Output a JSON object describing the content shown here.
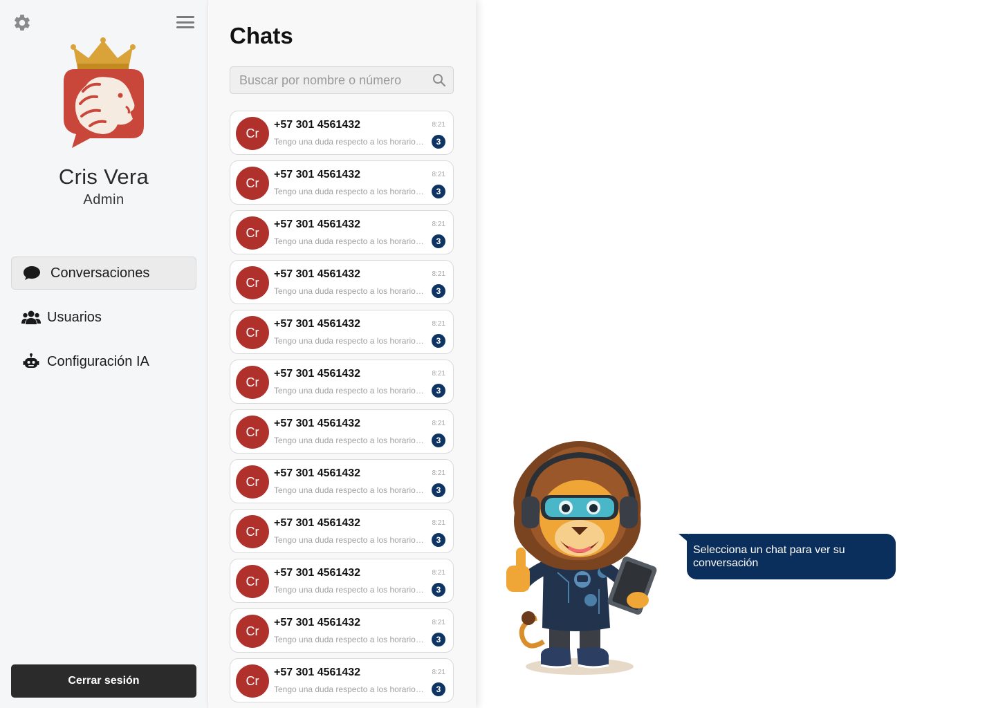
{
  "sidebar": {
    "icons": {
      "settings": "gear-icon",
      "menu": "hamburger-icon"
    },
    "logo_icon": "crowned-lion-logo",
    "user": {
      "name": "Cris Vera",
      "role": "Admin"
    },
    "nav": [
      {
        "label": "Conversaciones",
        "icon": "chat-bubble-icon",
        "active": true
      },
      {
        "label": "Usuarios",
        "icon": "users-icon",
        "active": false
      },
      {
        "label": "Configuración IA",
        "icon": "robot-icon",
        "active": false
      }
    ],
    "logout_label": "Cerrar sesión"
  },
  "chats": {
    "title": "Chats",
    "search": {
      "placeholder": "Buscar por nombre o número",
      "value": ""
    },
    "items": [
      {
        "initials": "Cr",
        "phone": "+57 301 4561432",
        "preview": "Tengo una duda respecto a los horarios de atención",
        "time": "8:21",
        "unread": "3"
      },
      {
        "initials": "Cr",
        "phone": "+57 301 4561432",
        "preview": "Tengo una duda respecto a los horarios de atención",
        "time": "8:21",
        "unread": "3"
      },
      {
        "initials": "Cr",
        "phone": "+57 301 4561432",
        "preview": "Tengo una duda respecto a los horarios de atención",
        "time": "8:21",
        "unread": "3"
      },
      {
        "initials": "Cr",
        "phone": "+57 301 4561432",
        "preview": "Tengo una duda respecto a los horarios de atención",
        "time": "8:21",
        "unread": "3"
      },
      {
        "initials": "Cr",
        "phone": "+57 301 4561432",
        "preview": "Tengo una duda respecto a los horarios de atención",
        "time": "8:21",
        "unread": "3"
      },
      {
        "initials": "Cr",
        "phone": "+57 301 4561432",
        "preview": "Tengo una duda respecto a los horarios de atención",
        "time": "8:21",
        "unread": "3"
      },
      {
        "initials": "Cr",
        "phone": "+57 301 4561432",
        "preview": "Tengo una duda respecto a los horarios de atención",
        "time": "8:21",
        "unread": "3"
      },
      {
        "initials": "Cr",
        "phone": "+57 301 4561432",
        "preview": "Tengo una duda respecto a los horarios de atención",
        "time": "8:21",
        "unread": "3"
      },
      {
        "initials": "Cr",
        "phone": "+57 301 4561432",
        "preview": "Tengo una duda respecto a los horarios de atención",
        "time": "8:21",
        "unread": "3"
      },
      {
        "initials": "Cr",
        "phone": "+57 301 4561432",
        "preview": "Tengo una duda respecto a los horarios de atención",
        "time": "8:21",
        "unread": "3"
      },
      {
        "initials": "Cr",
        "phone": "+57 301 4561432",
        "preview": "Tengo una duda respecto a los horarios de atención",
        "time": "8:21",
        "unread": "3"
      },
      {
        "initials": "Cr",
        "phone": "+57 301 4561432",
        "preview": "Tengo una duda respecto a los horarios de atención",
        "time": "8:21",
        "unread": "3"
      }
    ]
  },
  "main": {
    "mascot_icon": "lion-mascot-illustration",
    "empty_message": "Selecciona un chat para ver su conversación"
  },
  "colors": {
    "brand_red": "#b0302b",
    "badge_navy": "#0d3463",
    "bubble_navy": "#0b2f5c",
    "logout_dark": "#2b2b2b",
    "crown_gold": "#d9a33a"
  }
}
